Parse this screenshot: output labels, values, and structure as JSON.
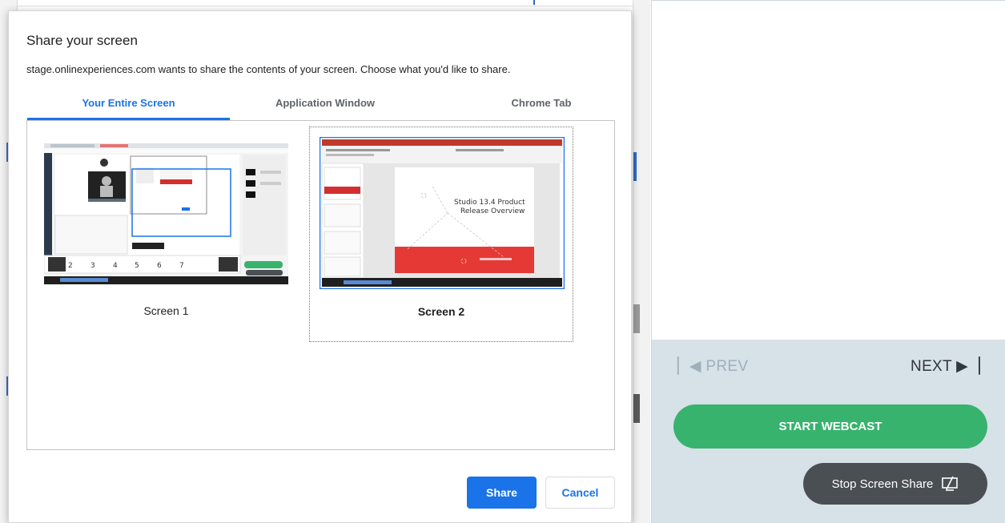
{
  "dialog": {
    "title": "Share your screen",
    "subtitle": "stage.onlinexperiences.com wants to share the contents of your screen. Choose what you'd like to share.",
    "tabs": [
      {
        "label": "Your Entire Screen",
        "active": true
      },
      {
        "label": "Application Window",
        "active": false
      },
      {
        "label": "Chrome Tab",
        "active": false
      }
    ],
    "screens": [
      {
        "label": "Screen 1",
        "selected": false
      },
      {
        "label": "Screen 2",
        "selected": true,
        "slide_title": "Studio 13.4 Product Release Overview"
      }
    ],
    "share_label": "Share",
    "cancel_label": "Cancel"
  },
  "panel": {
    "prev_label": "PREV",
    "next_label": "NEXT",
    "start_webcast_label": "START WEBCAST",
    "stop_share_label": "Stop Screen Share"
  },
  "colors": {
    "accent": "#1a73e8",
    "webcast_green": "#37b36e",
    "stop_button": "#4a4f54",
    "panel_bg": "#d6e1e8"
  }
}
